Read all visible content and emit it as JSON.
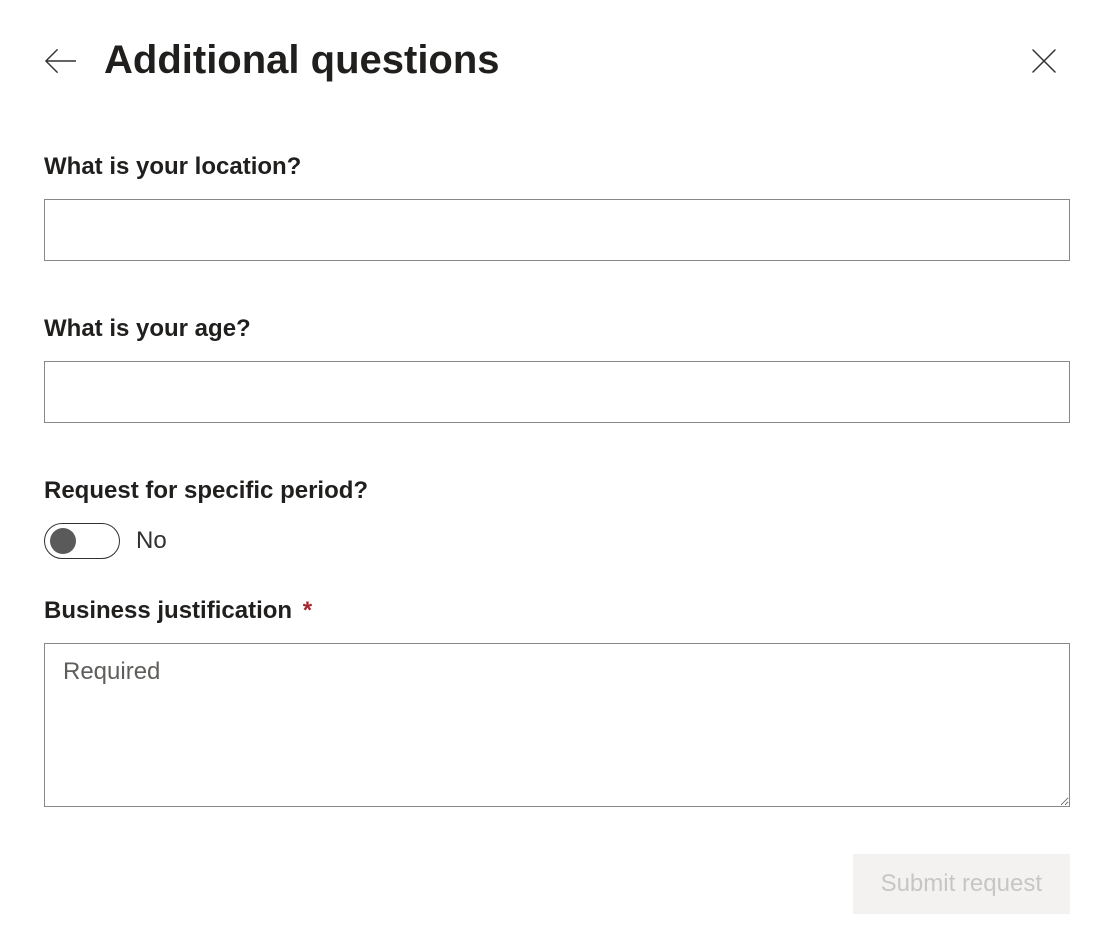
{
  "header": {
    "title": "Additional questions"
  },
  "form": {
    "location": {
      "label": "What is your location?",
      "value": ""
    },
    "age": {
      "label": "What is your age?",
      "value": ""
    },
    "period": {
      "label": "Request for specific period?",
      "toggle_value": "No"
    },
    "justification": {
      "label": "Business justification",
      "required_mark": "*",
      "placeholder": "Required",
      "value": ""
    }
  },
  "footer": {
    "submit_label": "Submit request"
  }
}
